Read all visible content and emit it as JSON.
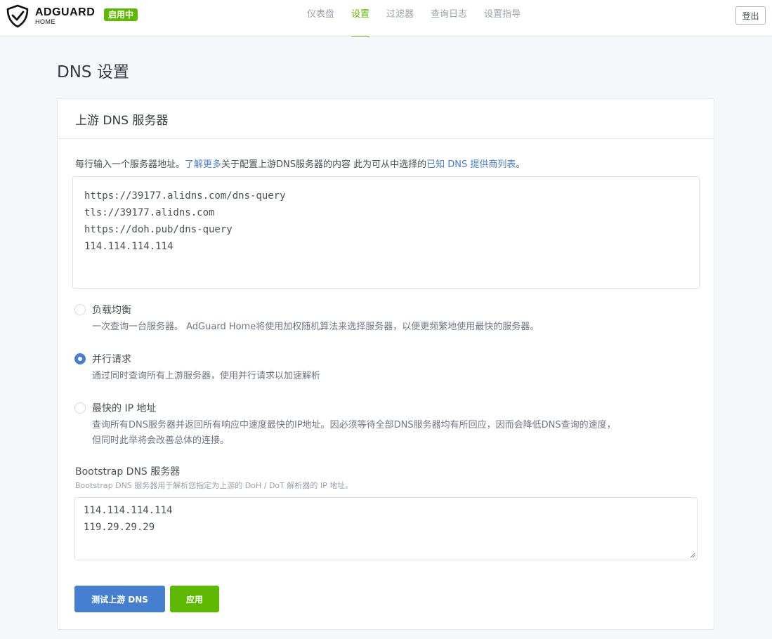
{
  "header": {
    "logo_main": "ADGUARD",
    "logo_sub": "HOME",
    "status_badge": "启用中",
    "nav": [
      {
        "label": "仪表盘"
      },
      {
        "label": "设置"
      },
      {
        "label": "过滤器"
      },
      {
        "label": "查询日志"
      },
      {
        "label": "设置指导"
      }
    ],
    "active_nav": "设置",
    "logout_label": "登出"
  },
  "page": {
    "title": "DNS 设置"
  },
  "upstream": {
    "card_title": "上游 DNS 服务器",
    "intro_prefix": "每行输入一个服务器地址。",
    "intro_link1": "了解更多",
    "intro_middle": "关于配置上游DNS服务器的内容 此为可从中选择的",
    "intro_link2": "已知 DNS 提供商列表",
    "intro_suffix": "。",
    "servers": [
      "https://39177.alidns.com/dns-query",
      "tls://39177.alidns.com",
      "https://doh.pub/dns-query",
      "114.114.114.114"
    ],
    "modes": [
      {
        "label": "负载均衡",
        "desc": [
          "一次查询一台服务器。 AdGuard Home将使用加权随机算法来选择服务器，以便更频繁地使用最快的服务器。"
        ],
        "checked": false
      },
      {
        "label": "并行请求",
        "desc": [
          "通过同时查询所有上游服务器，使用并行请求以加速解析"
        ],
        "checked": true
      },
      {
        "label": "最快的 IP 地址",
        "desc": [
          "查询所有DNS服务器并返回所有响应中速度最快的IP地址。因必须等待全部DNS服务器均有所回应，因而会降低DNS查询的速度，",
          "但同时此举将会改善总体的连接。"
        ],
        "checked": false
      }
    ]
  },
  "bootstrap": {
    "title": "Bootstrap DNS 服务器",
    "desc": "Bootstrap DNS 服务器用于解析您指定为上游的 DoH / DoT 解析器的 IP 地址。",
    "servers": [
      "114.114.114.114",
      "119.29.29.29"
    ]
  },
  "actions": {
    "test_label": "测试上游 DNS",
    "apply_label": "应用"
  },
  "colors": {
    "accent_green": "#5eba00",
    "accent_blue": "#467fcf"
  }
}
